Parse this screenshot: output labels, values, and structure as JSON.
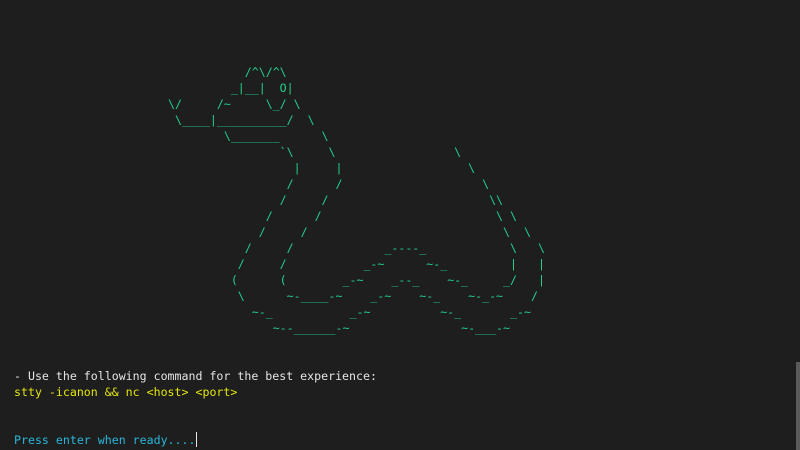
{
  "terminal": {
    "ascii_art": "           /^\\/^\\\n         _|__|  O|\n\\/     /~     \\_/ \\\n \\____|__________/  \\\n        \\_______      \\\n                `\\     \\                 \\\n                  |     |                  \\\n                 /      /                    \\\n                /     /                       \\\\\n              /      /                         \\ \\\n             /     /                            \\  \\\n           /     /             _----_            \\   \\\n          /     /           _-~      ~-_         |   |\n         (      (        _-~    _--_    ~-_     _/   |\n          \\      ~-____-~    _-~    ~-_    ~-_-~    /\n            ~-_           _-~          ~-_       _-~\n               ~--______-~                ~-___-~",
    "instruction": "- Use the following command for the best experience:",
    "command": "stty -icanon && nc <host> <port>",
    "prompt": "Press enter when ready...."
  }
}
